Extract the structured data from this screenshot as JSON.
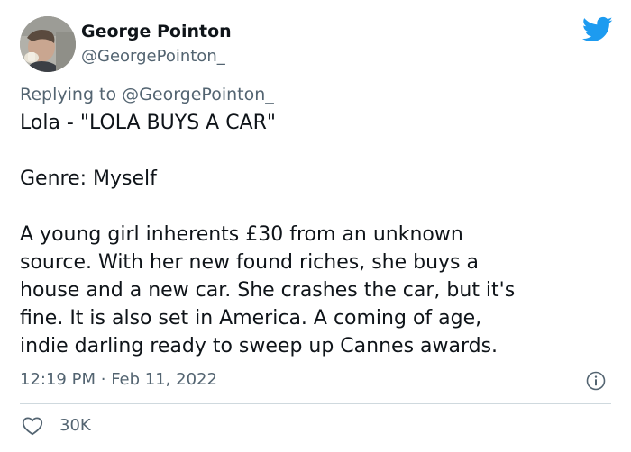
{
  "author": {
    "name": "George Pointon",
    "handle": "@GeorgePointon_"
  },
  "reply": {
    "prefix": "Replying to ",
    "mention": "@GeorgePointon_"
  },
  "tweet": {
    "title_line": "Lola - \"LOLA BUYS A CAR\"",
    "genre_line": "Genre: Myself",
    "body_lines": [
      "A young girl inherents £30 from an unknown",
      "source. With her new found riches, she buys a",
      "house and a new car. She crashes the car, but it's",
      "fine. It is also set in America. A coming of age,",
      "indie darling ready to sweep up Cannes awards."
    ],
    "time": "12:19 PM",
    "separator": "·",
    "date": "Feb 11, 2022"
  },
  "stats": {
    "likes": "30K"
  },
  "colors": {
    "brand": "#1d9bf0",
    "text": "#0f1419",
    "secondary": "#536471",
    "divider": "#cfd9de"
  },
  "icons": {
    "logo": "twitter-bird-icon",
    "info": "info-icon",
    "like": "heart-icon"
  }
}
